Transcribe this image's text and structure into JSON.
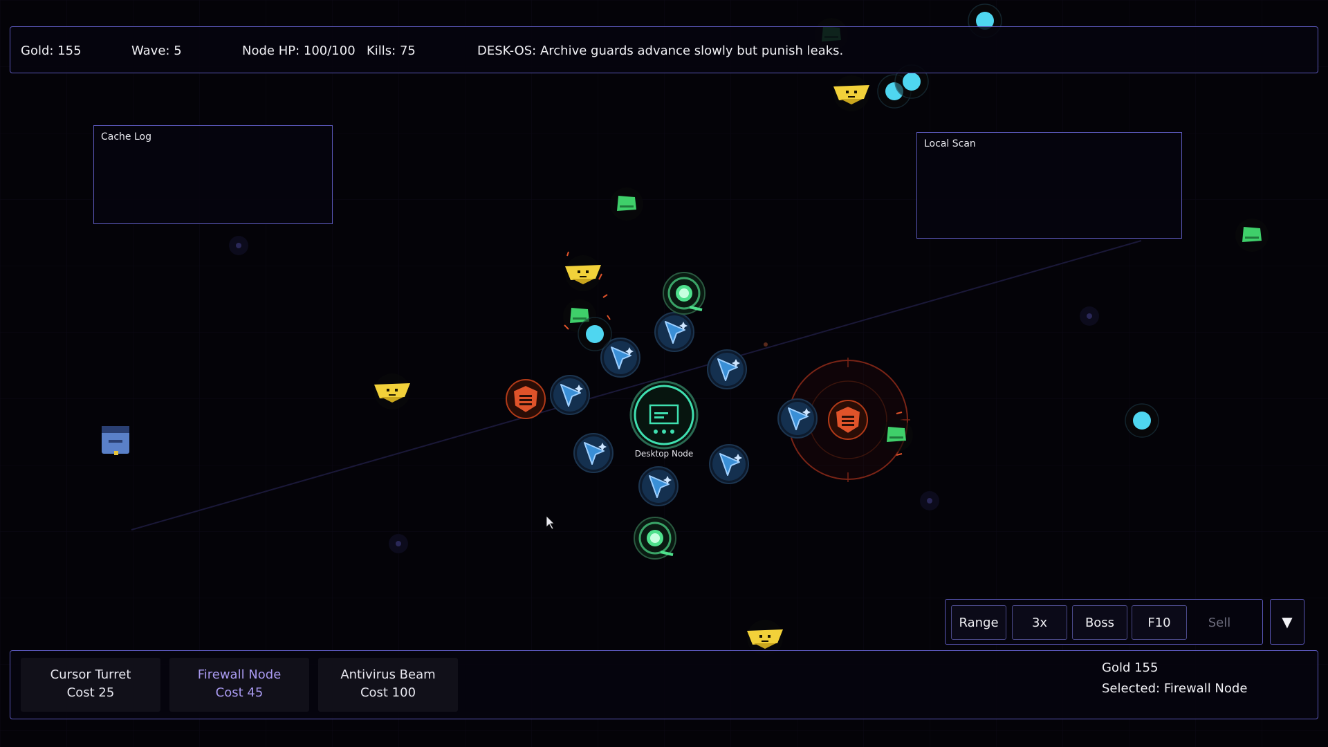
{
  "hud": {
    "gold": "Gold: 155",
    "wave": "Wave: 5",
    "node_hp": "Node HP: 100/100",
    "kills": "Kills: 75",
    "message": "DESK-OS: Archive guards advance slowly but punish leaks."
  },
  "windows": {
    "cache_log_title": "Cache Log",
    "local_scan_title": "Local Scan"
  },
  "core": {
    "label": "Desktop Node"
  },
  "controls": {
    "range": "Range",
    "speed": "3x",
    "boss": "Boss",
    "f10": "F10",
    "sell": "Sell",
    "collapse": "▼"
  },
  "build": {
    "items": [
      {
        "name": "Cursor Turret",
        "cost": "Cost 25"
      },
      {
        "name": "Firewall Node",
        "cost": "Cost 45"
      },
      {
        "name": "Antivirus Beam",
        "cost": "Cost 100"
      }
    ],
    "gold": "Gold 155",
    "selected": "Selected: Firewall Node"
  },
  "colors": {
    "panel_border": "#5a57b8",
    "cursor_turret": "#3a8fd6",
    "firewall": "#e0532a",
    "antivirus": "#4ee08c",
    "enemy_yellow": "#f2d13a",
    "enemy_green": "#3fcf6a",
    "enemy_cyan": "#4fd6f0"
  }
}
